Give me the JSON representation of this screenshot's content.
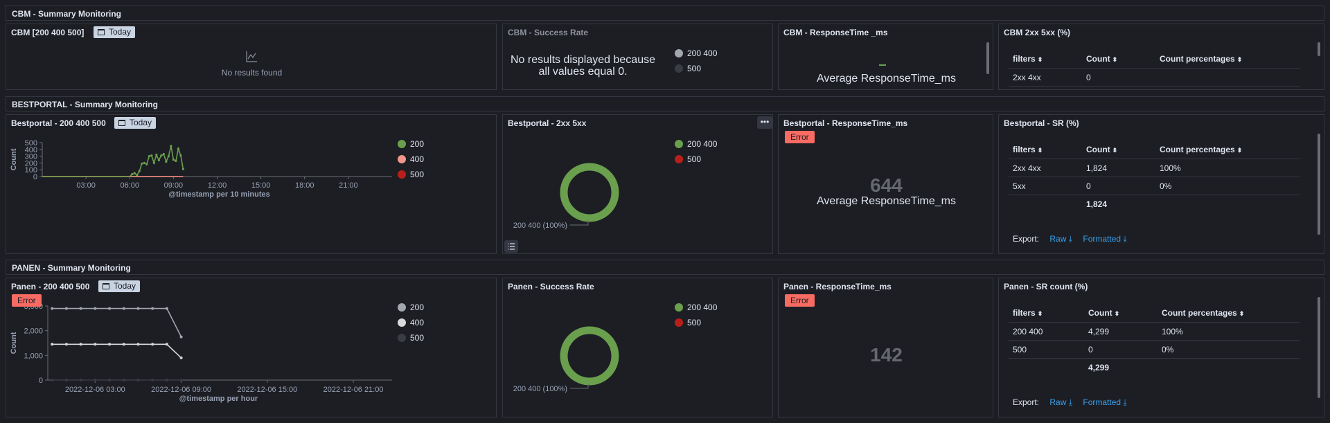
{
  "sections": {
    "cbm": "CBM - Summary Monitoring",
    "bestportal": "BESTPORTAL - Summary Monitoring",
    "panen": "PANEN - Summary Monitoring"
  },
  "common": {
    "today": "Today",
    "error": "Error",
    "export_label": "Export:",
    "raw": "Raw",
    "formatted": "Formatted",
    "filters": "filters",
    "count": "Count",
    "count_pct": "Count percentages",
    "avg_resp": "Average ResponseTime_ms"
  },
  "cbm": {
    "panel1_title": "CBM [200 400 500]",
    "no_results": "No results found",
    "panel2_title": "CBM - Success Rate",
    "no_results_zero": "No results displayed because all values equal 0.",
    "legend": [
      "200 400",
      "500"
    ],
    "panel3_title": "CBM - ResponseTime _ms",
    "panel4_title": "CBM 2xx 5xx (%)",
    "table_rows": [
      [
        "2xx 4xx",
        "0",
        ""
      ]
    ]
  },
  "bestportal": {
    "panel1_title": "Bestportal - 200 400 500",
    "legend1": [
      "200",
      "400",
      "500"
    ],
    "panel2_title": "Bestportal - 2xx 5xx",
    "legend2": [
      "200 400",
      "500"
    ],
    "donut_label": "200 400 (100%)",
    "panel3_title": "Bestportal - ResponseTime_ms",
    "metric": "644",
    "panel4_title": "Bestportal - SR (%)",
    "table_rows": [
      [
        "2xx 4xx",
        "1,824",
        "100%"
      ],
      [
        "5xx",
        "0",
        "0%"
      ]
    ],
    "total": "1,824"
  },
  "panen": {
    "panel1_title": "Panen - 200 400 500",
    "legend1": [
      "200",
      "400",
      "500"
    ],
    "panel2_title": "Panen - Success Rate",
    "legend2": [
      "200 400",
      "500"
    ],
    "donut_label": "200 400 (100%)",
    "panel3_title": "Panen - ResponseTime_ms",
    "metric": "142",
    "panel4_title": "Panen - SR count (%)",
    "table_rows": [
      [
        "200 400",
        "4,299",
        "100%"
      ],
      [
        "500",
        "0",
        "0%"
      ]
    ],
    "total": "4,299"
  },
  "colors": {
    "green": "#6a9f4d",
    "light_pink": "#f0968c",
    "red": "#b81f1b",
    "grey": "#a2a6ad",
    "light": "#d7d9dc",
    "dark": "#3a3c44",
    "link": "#36a2ef",
    "error": "#f86b63"
  },
  "chart_data": [
    {
      "type": "line",
      "xlabel": "@timestamp per 10 minutes",
      "ylabel": "Count",
      "ylim": [
        0,
        500
      ],
      "yticks": [
        0,
        100,
        200,
        300,
        400,
        500
      ],
      "xticks": [
        "03:00",
        "06:00",
        "09:00",
        "12:00",
        "15:00",
        "18:00",
        "21:00"
      ],
      "x": [
        "00:00",
        "06:00",
        "06:10",
        "06:20",
        "06:30",
        "06:40",
        "06:50",
        "07:00",
        "07:10",
        "07:20",
        "07:30",
        "07:40",
        "07:50",
        "08:00",
        "08:10",
        "08:20",
        "08:30",
        "08:40",
        "08:50",
        "09:00",
        "09:10",
        "09:20",
        "09:30",
        "09:40"
      ],
      "series": [
        {
          "name": "200",
          "values": [
            0,
            0,
            35,
            50,
            20,
            80,
            190,
            200,
            180,
            300,
            310,
            200,
            320,
            240,
            310,
            330,
            220,
            300,
            450,
            250,
            230,
            410,
            310,
            110
          ]
        },
        {
          "name": "400",
          "values": [
            0,
            0,
            0,
            0,
            0,
            0,
            0,
            0,
            0,
            0,
            0,
            0,
            0,
            0,
            0,
            0,
            0,
            0,
            0,
            0,
            0,
            0,
            0,
            0
          ]
        },
        {
          "name": "500",
          "values": [
            0,
            0,
            0,
            0,
            0,
            0,
            0,
            0,
            0,
            0,
            0,
            0,
            0,
            0,
            0,
            0,
            0,
            0,
            0,
            0,
            0,
            0,
            0,
            0
          ]
        }
      ]
    },
    {
      "type": "line",
      "xlabel": "@timestamp per hour",
      "ylabel": "Count",
      "ylim": [
        0,
        3000
      ],
      "yticks": [
        0,
        1000,
        2000,
        3000
      ],
      "ytick_labels": [
        "0",
        "1,000",
        "2,000",
        "3,000"
      ],
      "xticks": [
        "2022-12-06 03:00",
        "2022-12-06 09:00",
        "2022-12-06 15:00",
        "2022-12-06 21:00"
      ],
      "x": [
        "00:00",
        "01:00",
        "02:00",
        "03:00",
        "04:00",
        "05:00",
        "06:00",
        "07:00",
        "08:00",
        "09:00"
      ],
      "series": [
        {
          "name": "200",
          "values": [
            2900,
            2900,
            2900,
            2900,
            2900,
            2900,
            2900,
            2900,
            2900,
            1750
          ]
        },
        {
          "name": "400",
          "values": [
            1450,
            1450,
            1450,
            1450,
            1450,
            1450,
            1450,
            1450,
            1450,
            900
          ]
        },
        {
          "name": "500",
          "values": [
            0,
            0,
            0,
            0,
            0,
            0,
            0,
            0,
            0,
            0
          ]
        }
      ]
    },
    {
      "type": "pie",
      "categories": [
        "200 400",
        "500"
      ],
      "values": [
        100,
        0
      ]
    },
    {
      "type": "pie",
      "categories": [
        "200 400",
        "500"
      ],
      "values": [
        100,
        0
      ]
    }
  ]
}
